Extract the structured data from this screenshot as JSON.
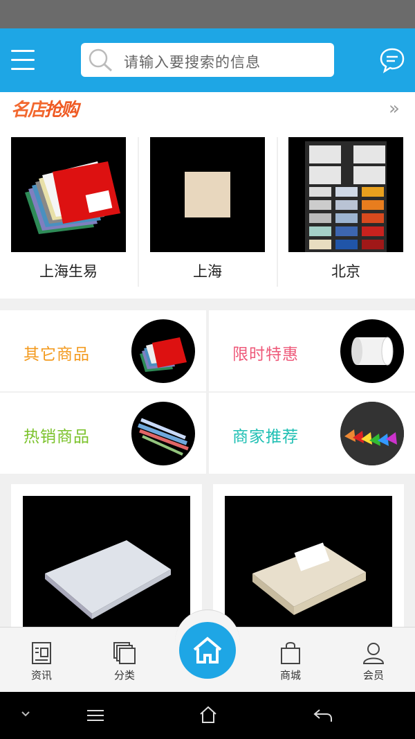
{
  "header": {
    "search_placeholder": "请输入要搜索的信息",
    "accent": "#1ea6e5"
  },
  "featured": {
    "title_part1": "名店",
    "title_part2": "抢购",
    "more_icon": "double-chevron-right-icon",
    "shops": [
      {
        "label": "上海生易"
      },
      {
        "label": "上海"
      },
      {
        "label": "北京"
      }
    ]
  },
  "categories": [
    {
      "label": "其它商品",
      "color": "#f39a1e"
    },
    {
      "label": "限时特惠",
      "color": "#ee5a7a"
    },
    {
      "label": "热销商品",
      "color": "#7bc22b"
    },
    {
      "label": "商家推荐",
      "color": "#1ebfb3"
    }
  ],
  "tabbar": {
    "items": [
      {
        "label": "资讯",
        "icon": "news-icon"
      },
      {
        "label": "分类",
        "icon": "category-icon"
      },
      {
        "label": "商城",
        "icon": "shopping-bag-icon"
      },
      {
        "label": "会员",
        "icon": "user-icon"
      }
    ],
    "home_icon": "home-icon"
  },
  "system_nav": {
    "icons": [
      "chevron-down-icon",
      "menu-icon",
      "home-outline-icon",
      "back-icon"
    ]
  }
}
